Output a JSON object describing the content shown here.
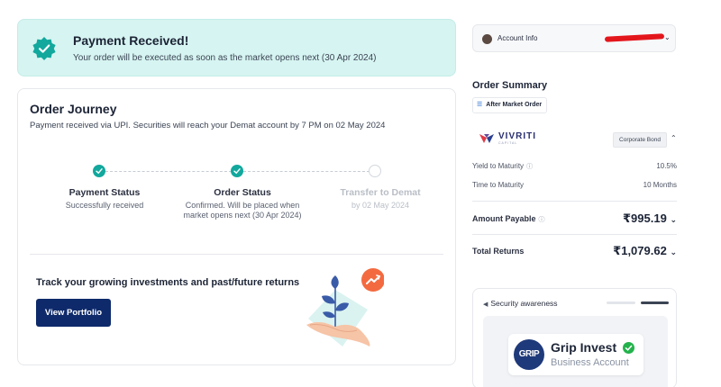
{
  "banner": {
    "title": "Payment Received!",
    "subtitle": "Your order will be executed as soon as the market opens next (30 Apr 2024)",
    "icon": "verified-badge-icon"
  },
  "journey": {
    "title": "Order Journey",
    "subtitle": "Payment received via UPI. Securities will reach your Demat account by 7 PM on 02 May 2024",
    "steps": [
      {
        "label": "Payment Status",
        "desc1": "Successfully received",
        "desc2": "",
        "state": "done"
      },
      {
        "label": "Order Status",
        "desc1": "Confirmed. Will be placed when",
        "desc2": "market opens next (30 Apr 2024)",
        "state": "done"
      },
      {
        "label": "Transfer to Demat",
        "desc1": "by 02 May 2024",
        "desc2": "",
        "state": "pending"
      }
    ],
    "track_text": "Track your growing investments and past/future returns",
    "view_portfolio": "View Portfolio"
  },
  "account": {
    "label": "Account Info"
  },
  "summary": {
    "title": "Order Summary",
    "order_type": "After Market Order",
    "issuer_name": "VIVRITI",
    "issuer_sub": "CAPITAL",
    "bond_type": "Corporate Bond",
    "ytm_label": "Yield to Maturity",
    "ytm_value": "10.5%",
    "ttm_label": "Time to Maturity",
    "ttm_value": "10 Months",
    "amount_label": "Amount Payable",
    "amount_value": "₹995.19",
    "returns_label": "Total Returns",
    "returns_value": "₹1,079.62"
  },
  "security": {
    "title": "Security awareness",
    "brand_logo": "GRIP",
    "brand_name": "Grip Invest",
    "brand_sub": "Business Account"
  },
  "colors": {
    "accent": "#12a89d",
    "banner_bg": "#d6f4f1",
    "primary_button": "#0e2a6b"
  }
}
